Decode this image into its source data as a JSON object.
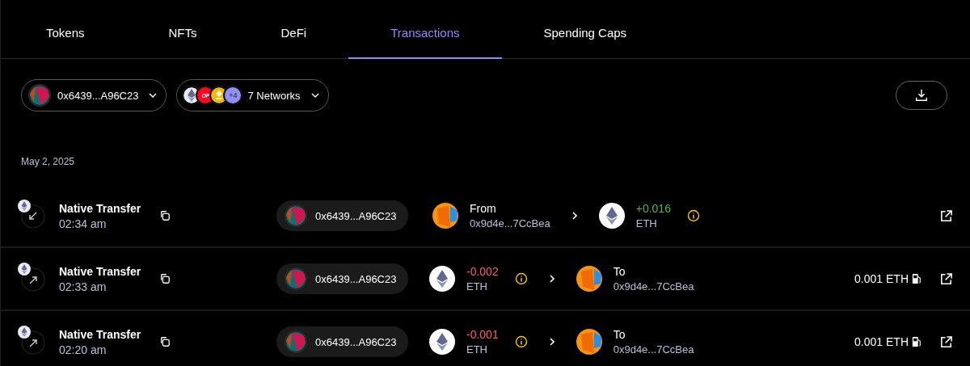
{
  "tabs": [
    {
      "label": "Tokens",
      "selected": false
    },
    {
      "label": "NFTs",
      "selected": false
    },
    {
      "label": "DeFi",
      "selected": false
    },
    {
      "label": "Transactions",
      "selected": true
    },
    {
      "label": "Spending Caps",
      "selected": false
    }
  ],
  "filters": {
    "account": "0x6439...A96C23",
    "op_logo": "OP",
    "network_more": "+4",
    "networks": "7 Networks"
  },
  "date": "May 2, 2025",
  "transactions": [
    {
      "kind": "incoming",
      "title": "Native Transfer",
      "time": "02:34 am",
      "account": "0x6439...A96C23",
      "amount": "+0.016",
      "asset": "ETH",
      "direction": "From",
      "counterparty": "0x9d4e...7CcBea"
    },
    {
      "kind": "outgoing",
      "title": "Native Transfer",
      "time": "02:33 am",
      "account": "0x6439...A96C23",
      "amount": "-0.002",
      "asset": "ETH",
      "direction": "To",
      "counterparty": "0x9d4e...7CcBea",
      "fee": "0.001 ETH"
    },
    {
      "kind": "outgoing",
      "title": "Native Transfer",
      "time": "02:20 am",
      "account": "0x6439...A96C23",
      "amount": "-0.001",
      "asset": "ETH",
      "direction": "To",
      "counterparty": "0x9d4e...7CcBea",
      "fee": "0.001 ETH"
    }
  ]
}
